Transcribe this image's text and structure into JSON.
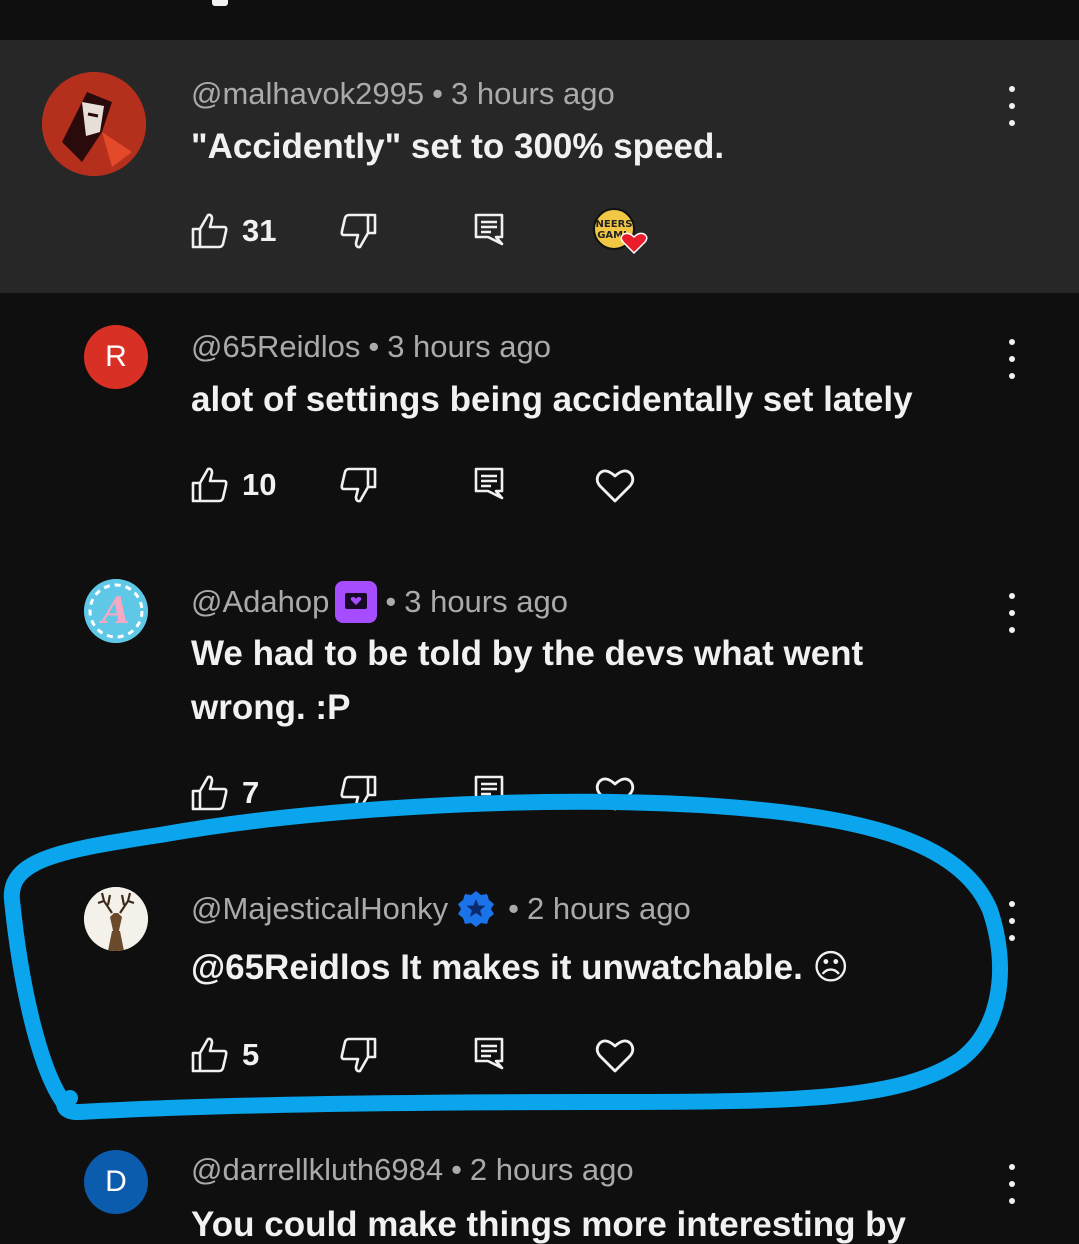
{
  "comments": [
    {
      "handle": "@malhavok2995",
      "time": "3 hours ago",
      "text": "\"Accidently\" set to 300% speed.",
      "likes": "31",
      "creator_heart_label": "NEERS GAMI"
    },
    {
      "handle": "@65Reidlos",
      "avatar_letter": "R",
      "time": "3 hours ago",
      "text": "alot of settings being accidentally set lately",
      "likes": "10"
    },
    {
      "handle": "@Adahop",
      "avatar_letter": "A",
      "time": "3 hours ago",
      "text": "We had to be told by the devs what went wrong. :P",
      "likes": "7"
    },
    {
      "handle": "@MajesticalHonky",
      "time": "2 hours ago",
      "text": "@65Reidlos It makes it unwatchable. ☹",
      "likes": "5"
    },
    {
      "handle": "@darrellkluth6984",
      "avatar_letter": "D",
      "time": "2 hours ago",
      "text": "You could make things more interesting by"
    }
  ],
  "separator": "•",
  "colors": {
    "background": "#0f0f0f",
    "highlight_background": "#272727",
    "annotation_circle": "#0aa5ec",
    "avatar_r": "#d93025",
    "avatar_d": "#0b5cad",
    "member_badge": "#a64dff",
    "verified_badge": "#1a73e8"
  }
}
